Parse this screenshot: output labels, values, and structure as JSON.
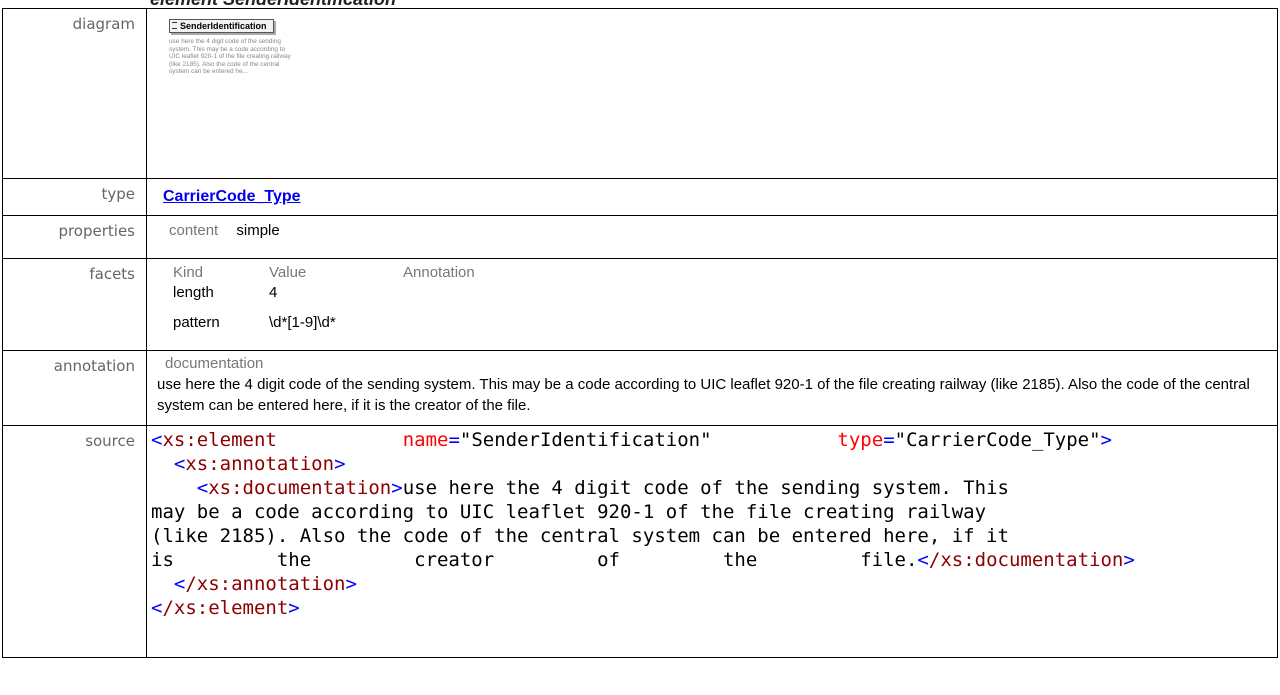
{
  "rows": {
    "diagram": {
      "label": "diagram",
      "box_title": "SenderIdentification",
      "box_note": "use here the 4 digit code of the sending system. This may be a code according to UIC leaflet 920-1 of the file creating railway (like 2185). Also the code of the central system can be entered he..."
    },
    "type": {
      "label": "type",
      "value": "CarrierCode_Type"
    },
    "properties": {
      "label": "properties",
      "key": "content",
      "value": "simple"
    },
    "facets": {
      "label": "facets",
      "headers": [
        "Kind",
        "Value",
        "Annotation"
      ],
      "items": [
        {
          "kind": "length",
          "value": "4"
        },
        {
          "kind": "pattern",
          "value": "\\d*[1-9]\\d*"
        }
      ]
    },
    "annotation": {
      "label": "annotation",
      "header": "documentation",
      "text": "use here the 4 digit code of the sending system. This may be a code according to UIC leaflet 920-1 of the file creating railway (like 2185). Also the code of the central system can be entered here, if it is the creator of the file."
    },
    "source": {
      "label": "source",
      "el_open": "xs:element",
      "attr1_name": "name",
      "attr1_value": "\"SenderIdentification\"",
      "attr2_name": "type",
      "attr2_value": "\"CarrierCode_Type\"",
      "annotation_tag": "xs:annotation",
      "documentation_tag": "xs:documentation",
      "doc_text_1": "use here the 4 digit code of the sending system. This",
      "doc_text_2": "may be a code according to UIC leaflet 920-1 of the file creating railway",
      "doc_text_3": "(like 2185). Also the code of the central system can be entered here, if it",
      "doc_text_4": "is         the         creator         of         the         file.",
      "documentation_close": "/xs:documentation",
      "annotation_close": "/xs:annotation",
      "element_close": "/xs:element"
    }
  },
  "colors": {
    "tag": "#8b0000",
    "attr": "#ff0000",
    "angle": "#0000ff",
    "link": "#0000ee"
  }
}
